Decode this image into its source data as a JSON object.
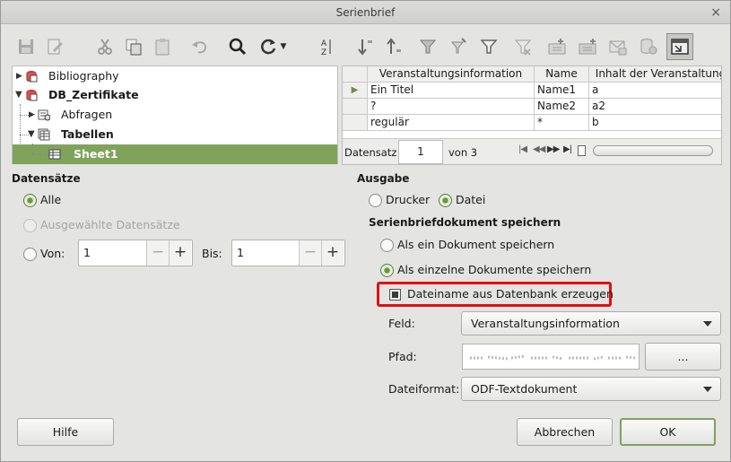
{
  "window": {
    "title": "Serienbrief",
    "close_glyph": "×"
  },
  "toolbar": {
    "icons": [
      "save-icon",
      "edit-icon",
      "cut-icon",
      "copy-icon",
      "paste-icon",
      "undo-icon",
      "find-icon",
      "refresh-icon",
      "sort-icon",
      "sort-ascending-icon",
      "sort-descending-icon",
      "autofilter-icon",
      "standard-filter-icon",
      "apply-filter-icon",
      "remove-filter-icon",
      "data-to-text-icon",
      "data-to-fields-icon",
      "mail-merge-icon",
      "data-source-icon",
      "explorer-toggle-icon"
    ]
  },
  "tree": {
    "items": [
      {
        "label": "Bibliography",
        "expanded": false
      },
      {
        "label": "DB_Zertifikate",
        "expanded": true
      },
      {
        "label": "Abfragen",
        "expanded": false
      },
      {
        "label": "Tabellen",
        "expanded": true
      },
      {
        "label": "Sheet1",
        "selected": true
      }
    ]
  },
  "table": {
    "columns": [
      "Veranstaltungsinformation",
      "Name",
      "Inhalt der Veranstaltung"
    ],
    "rows": [
      [
        "Ein Titel",
        "Name1",
        "a"
      ],
      [
        "?",
        "Name2",
        "a2"
      ],
      [
        "regulär",
        "*",
        "b"
      ]
    ],
    "nav": {
      "label": "Datensatz",
      "current": "1",
      "of_label": "von 3"
    }
  },
  "records": {
    "heading": "Datensätze",
    "all_label": "Alle",
    "selected_label": "Ausgewählte Datensätze",
    "from_label": "Von:",
    "from_value": "1",
    "to_label": "Bis:",
    "to_value": "1",
    "minus": "−",
    "plus": "+"
  },
  "output": {
    "heading": "Ausgabe",
    "printer_label": "Drucker",
    "file_label": "Datei",
    "save_heading": "Serienbriefdokument speichern",
    "as_one_label": "Als ein Dokument speichern",
    "as_single_label": "Als einzelne Dokumente speichern",
    "filename_from_db_label": "Dateiname aus Datenbank erzeugen",
    "field_label": "Feld:",
    "field_value": "Veranstaltungsinformation",
    "path_label": "Pfad:",
    "browse_label": "...",
    "format_label": "Dateiformat:",
    "format_value": "ODF-Textdokument"
  },
  "buttons": {
    "help": "Hilfe",
    "cancel": "Abbrechen",
    "ok": "OK"
  },
  "colors": {
    "accent": "#7fa35b",
    "highlight": "#e01010"
  }
}
